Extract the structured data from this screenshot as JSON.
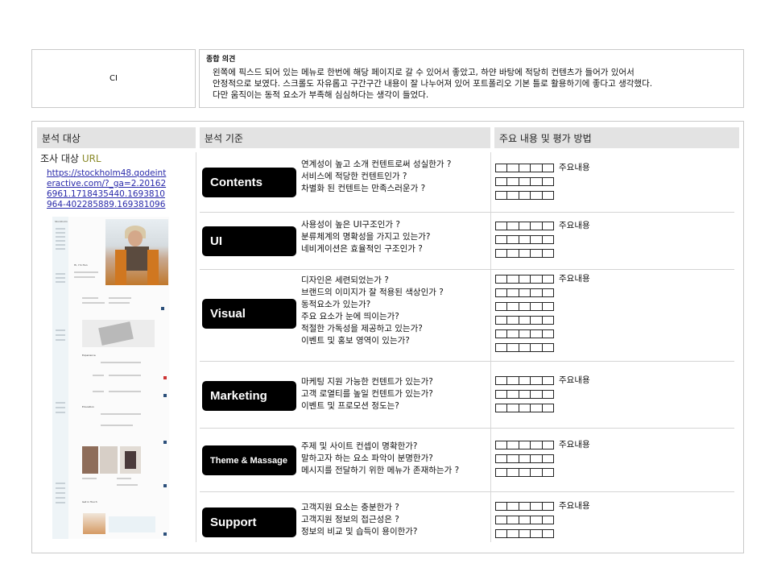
{
  "summary": {
    "ci_label": "CI",
    "opinion_title": "종합 의견",
    "opinion_lines": [
      "왼쪽에 픽스드 되어 있는 메뉴로 한번에 해당 페이지로 갈 수 있어서 좋았고, 하얀 바탕에 적당히 컨텐츠가 들어가 있어서",
      "안정적으로 보였다. 스크롤도 자유롭고 구간구간 내용이 잘 나누어져 있어 포트폴리오 기본 틀로 활용하기에 좋다고 생각했다.",
      "다만 움직이는 동적 요소가 부족해 심심하다는 생각이 들었다."
    ]
  },
  "headers": {
    "target": "분석 대상",
    "criteria": "분석 기준",
    "evaluation": "주요 내용 및 평가 방법"
  },
  "target": {
    "title_prefix": "조사 대상",
    "title_suffix": "URL",
    "url": "https://stockholm48.qodeinteractive.com/?_ga=2.201626961.1718435440.1693810964-402285889.1693810964",
    "thumbnail_texts": {
      "brand": "Stockholm",
      "hello": "Hi, I'm Hun",
      "experience": "Experience",
      "education": "Education",
      "contact": "Get in Touch"
    }
  },
  "criteria": [
    {
      "label": "Contents",
      "questions": [
        "연계성이 높고 소개 컨텐트로써 성실한가 ?",
        "서비스에 적당한 컨텐트인가 ?",
        "차별화 된 컨텐트는 만족스러운가 ?"
      ],
      "eval_label": "주요내용",
      "eval_rows": 3
    },
    {
      "label": "UI",
      "questions": [
        "사용성이 높은 UI구조인가 ?",
        "분류체계의 명확성을 가지고 있는가?",
        "네비게이션은 효율적인 구조인가 ?"
      ],
      "eval_label": "주요내용",
      "eval_rows": 3
    },
    {
      "label": "Visual",
      "questions": [
        "디자인은 세련되었는가 ?",
        "브랜드의 이미지가 잘 적용된 색상인가 ?",
        "동적요소가 있는가?",
        "주요 요소가 눈에 띄이는가?",
        "적절한 가독성을 제공하고 있는가?",
        "이벤트 및 홍보 영역이 있는가?"
      ],
      "eval_label": "주요내용",
      "eval_rows": 6
    },
    {
      "label": "Marketing",
      "questions": [
        "마케팅 지원 가능한 컨텐트가 있는가?",
        "고객 로열티를 높일 컨텐트가 있는가?",
        "이벤트 및 프로모션 정도는?"
      ],
      "eval_label": "주요내용",
      "eval_rows": 3
    },
    {
      "label": "Theme & Massage",
      "questions": [
        "주제 및 사이트 컨셉이 명확한가?",
        "말하고자 하는 요소 파악이 분명한가?",
        "메시지를 전달하기 위한 메뉴가 존재하는가 ?"
      ],
      "eval_label": "주요내용",
      "eval_rows": 3
    },
    {
      "label": "Support",
      "questions": [
        "고객지원 요소는 충분한가 ?",
        "고객지원 정보의 접근성은 ?",
        "정보의 비교 및 습득이 용이한가?"
      ],
      "eval_label": "주요내용",
      "eval_rows": 3
    }
  ],
  "colors": {
    "header_bg": "#e3e3e3",
    "pill_bg": "#000000",
    "border": "#c9c9c9",
    "url_word": "#8a8a2a",
    "link": "#2a2aaa"
  }
}
